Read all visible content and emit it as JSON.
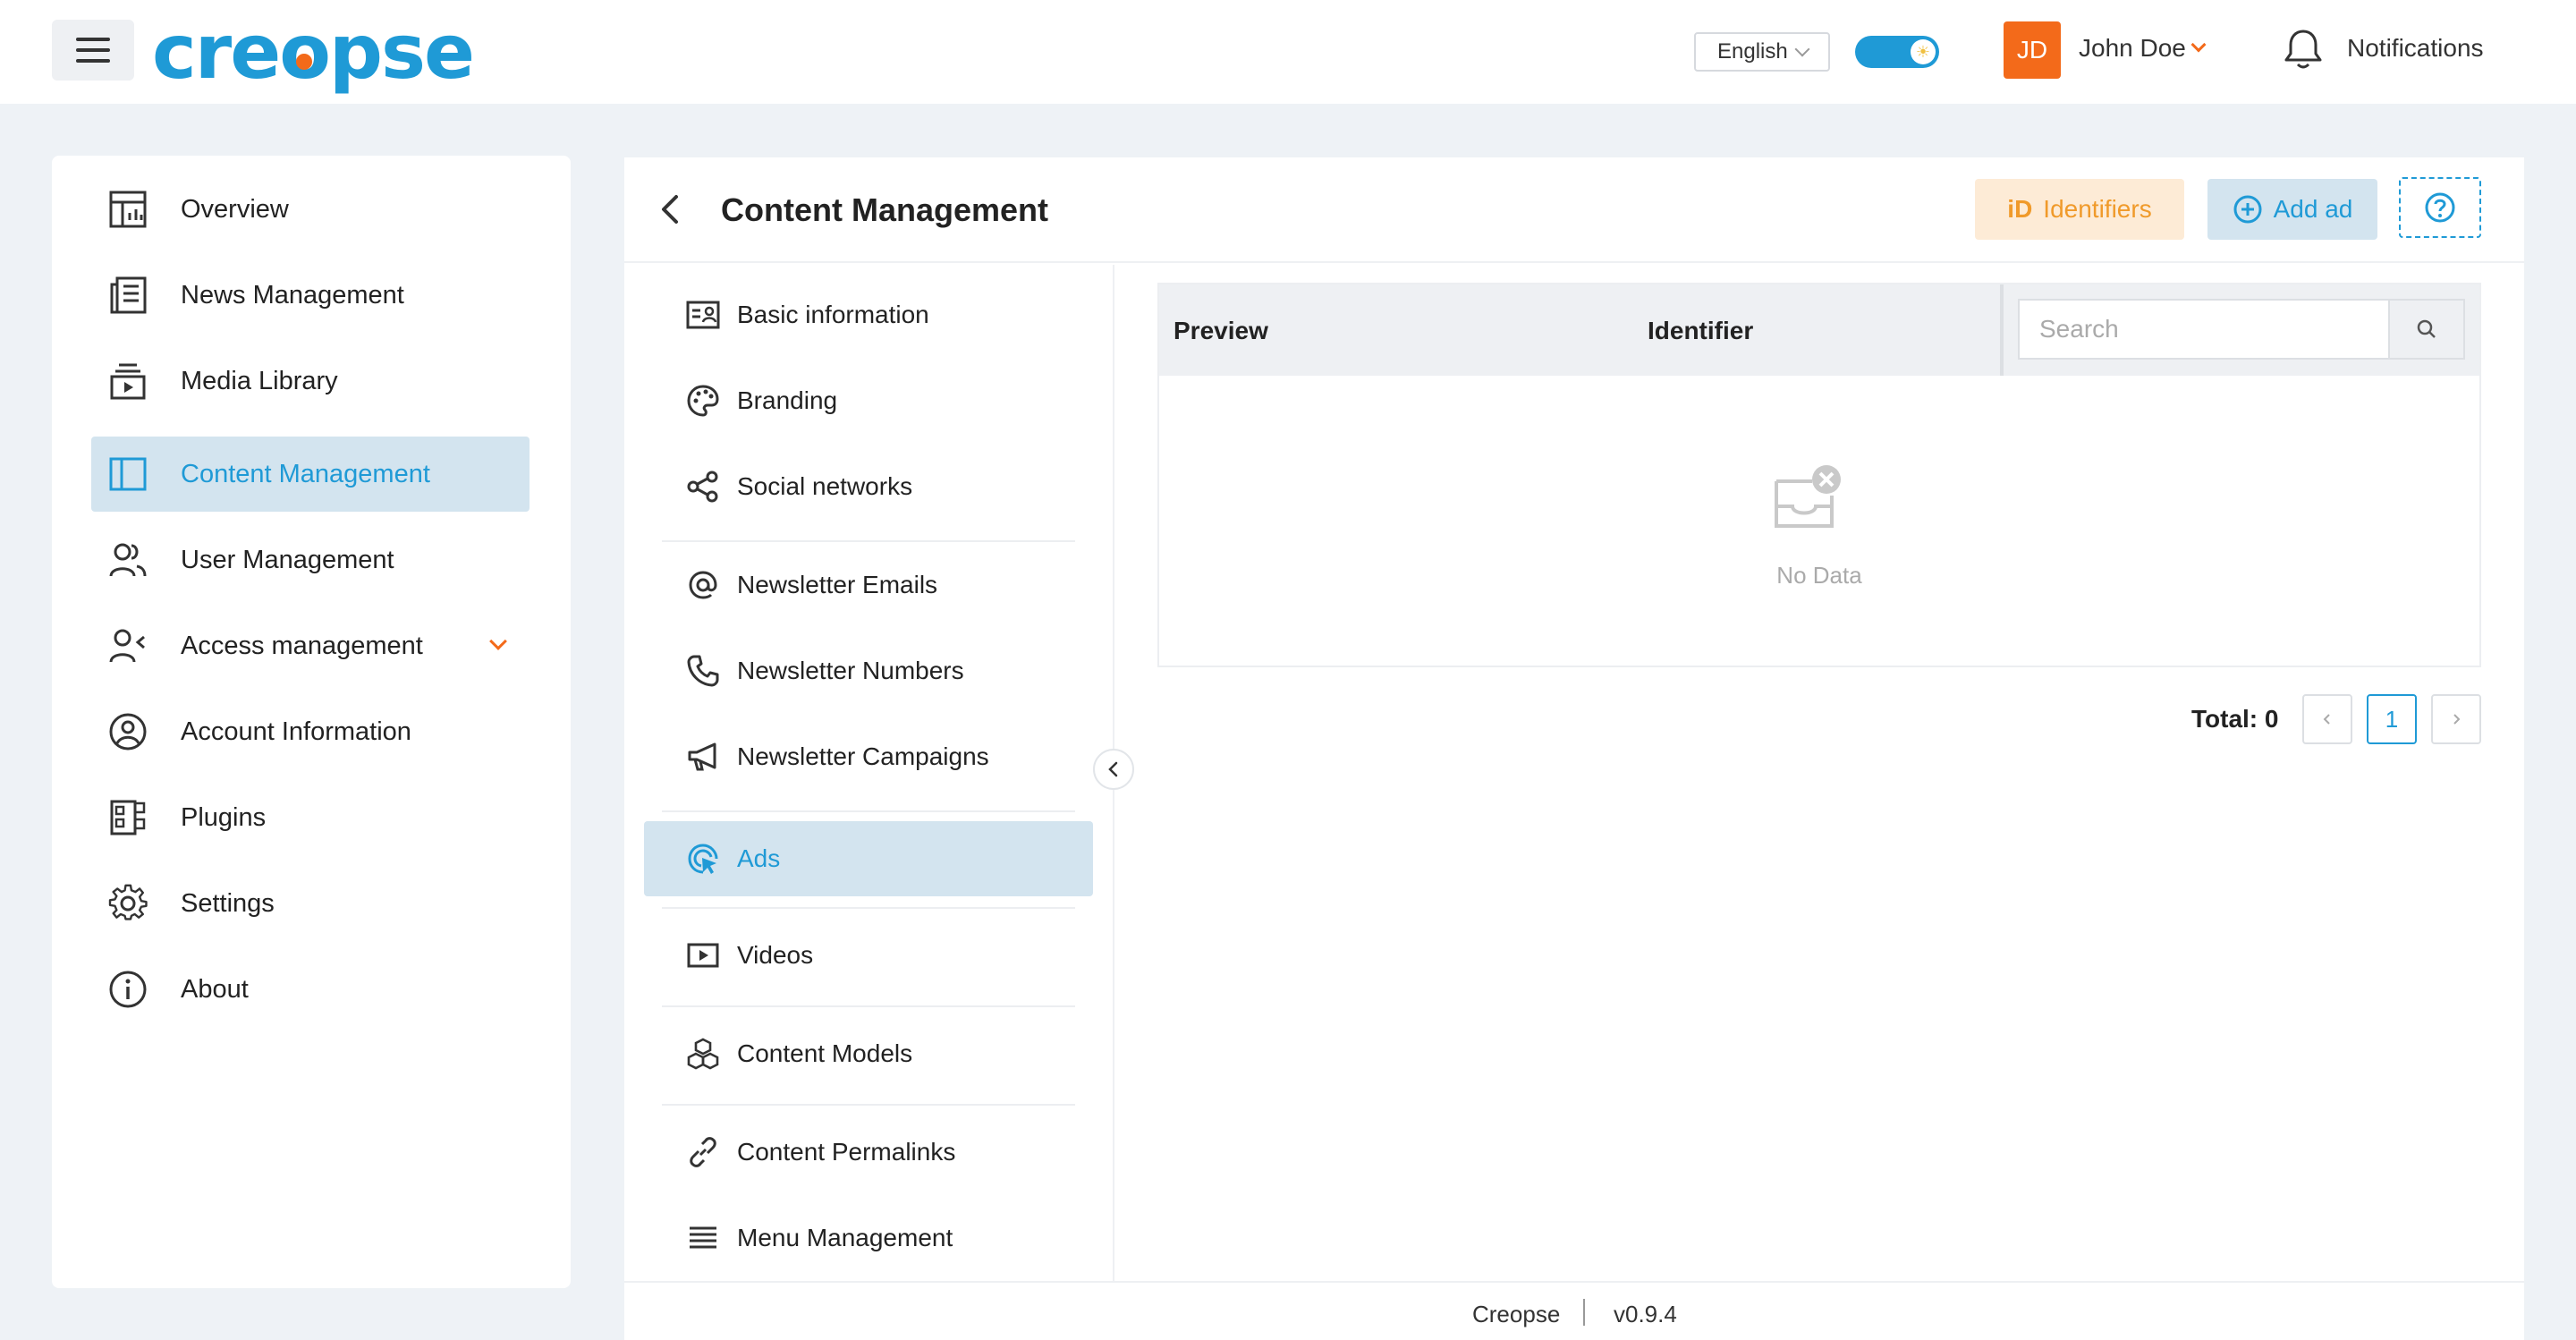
{
  "header": {
    "logo_text": "creopse",
    "language": "English",
    "user": {
      "initials": "JD",
      "name": "John Doe"
    },
    "notifications_label": "Notifications"
  },
  "sidebar": {
    "items": [
      {
        "label": "Overview",
        "icon": "dashboard-icon"
      },
      {
        "label": "News Management",
        "icon": "newspaper-icon"
      },
      {
        "label": "Media Library",
        "icon": "media-icon"
      },
      {
        "label": "Content Management",
        "icon": "layout-icon",
        "active": true
      },
      {
        "label": "User Management",
        "icon": "users-icon"
      },
      {
        "label": "Access management",
        "icon": "user-access-icon",
        "expandable": true
      },
      {
        "label": "Account Information",
        "icon": "account-icon"
      },
      {
        "label": "Plugins",
        "icon": "plugins-icon"
      },
      {
        "label": "Settings",
        "icon": "gear-icon"
      },
      {
        "label": "About",
        "icon": "info-icon"
      }
    ]
  },
  "main": {
    "title": "Content Management",
    "identifiers_label": "Identifiers",
    "identifiers_icon_text": "iD",
    "add_ad_label": "Add ad"
  },
  "subnav": {
    "items": [
      {
        "label": "Basic information",
        "icon": "id-card-icon"
      },
      {
        "label": "Branding",
        "icon": "palette-icon"
      },
      {
        "label": "Social networks",
        "icon": "share-icon"
      },
      {
        "label": "Newsletter Emails",
        "icon": "at-icon"
      },
      {
        "label": "Newsletter Numbers",
        "icon": "phone-icon"
      },
      {
        "label": "Newsletter Campaigns",
        "icon": "megaphone-icon"
      },
      {
        "label": "Ads",
        "icon": "target-cursor-icon",
        "active": true
      },
      {
        "label": "Videos",
        "icon": "video-icon"
      },
      {
        "label": "Content Models",
        "icon": "cubes-icon"
      },
      {
        "label": "Content Permalinks",
        "icon": "link-icon"
      },
      {
        "label": "Menu Management",
        "icon": "menu-icon"
      }
    ]
  },
  "table": {
    "columns": [
      "Preview",
      "Identifier"
    ],
    "search_placeholder": "Search",
    "empty_text": "No Data"
  },
  "pagination": {
    "total_label": "Total: 0",
    "current_page": "1"
  },
  "footer": {
    "brand": "Creopse",
    "version": "v0.9.4"
  },
  "colors": {
    "accent": "#1f9ad6",
    "brand_orange": "#f36a1a",
    "active_bg": "#d3e4ef",
    "identifiers_bg": "#fdebd6",
    "identifiers_fg": "#f09a2a"
  }
}
